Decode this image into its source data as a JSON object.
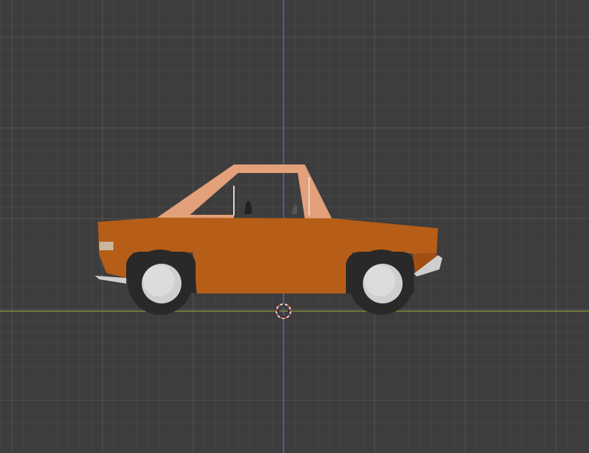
{
  "viewport": {
    "background_color": "#3d3d3d",
    "axis_colors": {
      "z_axis": "#4a6fbf",
      "x_axis": "#8a9b3a"
    }
  },
  "scene": {
    "object": "car",
    "body_color": "#b65d18",
    "cabin_color": "#e3a07a",
    "tire_color": "#2a2828",
    "hub_color": "#cfcfcf",
    "trim_color": "#cfcfcf",
    "cursor_colors": [
      "#e8e8e8",
      "#d23c3c"
    ]
  }
}
